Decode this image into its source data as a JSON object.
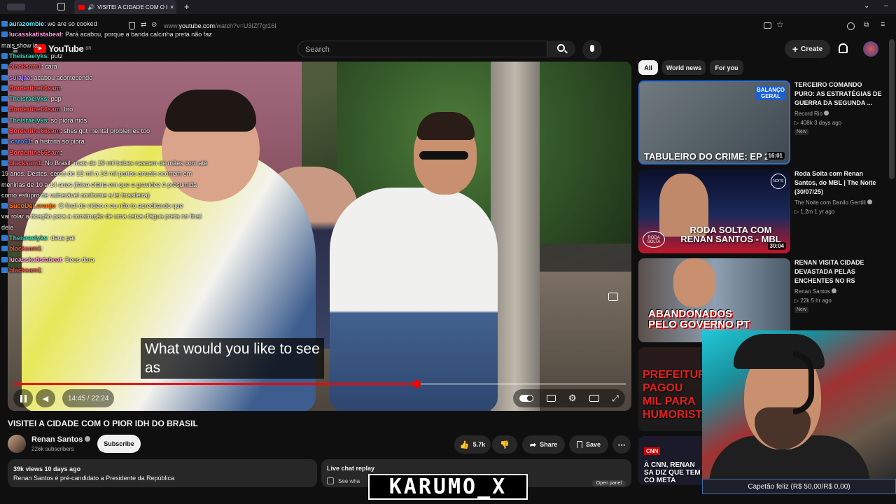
{
  "browser": {
    "tab_title": "VISITEI A CIDADE COM O PI",
    "url_prefix": "www.",
    "url_domain": "youtube.com",
    "url_path": "/watch?v=U3IZf7gt16I"
  },
  "header": {
    "logo": "YouTube",
    "region": "BR",
    "search_placeholder": "Search",
    "create_label": "Create"
  },
  "chat_overlay": [
    {
      "user": "aurazombie",
      "color": "#67e8ff",
      "msg": "we are so cooked"
    },
    {
      "user": "lucasskatistabeat",
      "color": "#ff9bdc",
      "msg": "Pará acabou, porque a banda calcinha preta não faz"
    },
    {
      "user": "",
      "color": "#ffffff",
      "msg": "mais show lá"
    },
    {
      "user": "Theisraelyks",
      "color": "#38d6b6",
      "msg": "putz"
    },
    {
      "user": "blacksam1",
      "color": "#ff4f4f",
      "msg": "cara"
    },
    {
      "user": "sulajaa",
      "color": "#b38cff",
      "msg": "acabou acontecendo"
    },
    {
      "user": "Borderline66sam",
      "color": "#ff4f4f",
      "msg": ""
    },
    {
      "user": "Theisraelyks",
      "color": "#38d6b6",
      "msg": "pqp"
    },
    {
      "user": "Borderline66sam",
      "color": "#ff4f4f",
      "msg": "bro"
    },
    {
      "user": "Theisraelyks",
      "color": "#38d6b6",
      "msg": "só piora mds"
    },
    {
      "user": "Borderline66sam",
      "color": "#ff4f4f",
      "msg": "shes got mental problemes too"
    },
    {
      "user": "icaro91",
      "color": "#4f8fff",
      "msg": "a historia so piora"
    },
    {
      "user": "Borderline66sam",
      "color": "#ff4f4f",
      "msg": ""
    },
    {
      "user": "blacksam1",
      "color": "#ff4f4f",
      "msg": "No Brasil, mais de 19 mil bebes nascem de mães com até"
    },
    {
      "user": "",
      "color": "#ffffff",
      "msg": "19 anos. Destes, cerca de 12 mil a 14 mil partos anuais ocorrem em"
    },
    {
      "user": "",
      "color": "#ffffff",
      "msg": "meninas de 10 a 14 anos (faixa etária em que a gravidez é presumida"
    },
    {
      "user": "",
      "color": "#ffffff",
      "msg": "como estupro de vulnerável conforme a lei brasileira)"
    },
    {
      "user": "SucoDeLaranjo",
      "color": "#ff7a1a",
      "msg": "O final do vídeo e eu não to acreditando que"
    },
    {
      "user": "",
      "color": "#ffffff",
      "msg": "vai rolar a doação para a construção de uma caixa d'água preta no final"
    },
    {
      "user": "",
      "color": "#ffffff",
      "msg": "dele"
    },
    {
      "user": "Theisraelyks",
      "color": "#38d6b6",
      "msg": "deus pai"
    },
    {
      "user": "blacksam1",
      "color": "#ff4f4f",
      "msg": ""
    },
    {
      "user": "lucasskatistabeat",
      "color": "#ff9bdc",
      "msg": "Deus dara"
    },
    {
      "user": "blacksam1",
      "color": "#ff4f4f",
      "msg": ""
    }
  ],
  "video": {
    "caption_line1": "What would you like to see",
    "caption_line2": "as",
    "current_time": "14:45",
    "duration": "22:24",
    "progress": 0.658
  },
  "info": {
    "title": "VISITEI A CIDADE COM O PIOR IDH DO BRASIL",
    "channel": "Renan Santos",
    "subscribers": "226k subscribers",
    "subscribe_label": "Subscribe",
    "likes": "5.7k",
    "share_label": "Share",
    "save_label": "Save",
    "views_date": "39k views  10 days ago",
    "description": "Renan Santos é pré-candidato a Presidente da República",
    "live_chat_label": "Live chat replay",
    "live_chat_sub": "See wha",
    "open_panel": "Open panel"
  },
  "chips": [
    "All",
    "World news",
    "For you"
  ],
  "related": [
    {
      "title": "TERCEIRO COMANDO PURO: AS ESTRATÉGIAS DE GUERRA DA SEGUNDA ...",
      "channel": "Record Rio",
      "meta": "408k  3 days ago",
      "badge": "New",
      "duration": "16:01",
      "thumb_text": "TABULEIRO DO CRIME: EP 2",
      "thumb_tag": "BALANÇO GERAL"
    },
    {
      "title": "Roda Solta com Renan Santos, do MBL | The Noite (30/07/25)",
      "channel": "The Noite com Danilo Gentili",
      "meta": "1.2m  1 yr ago",
      "badge": "",
      "duration": "30:04",
      "thumb_text": "RODA SOLTA COM RENAN SANTOS - MBL",
      "thumb_tag": "RODA SOLTA"
    },
    {
      "title": "RENAN VISITA CIDADE DEVASTADA PELAS ENCHENTES NO RS",
      "channel": "Renan Santos",
      "meta": "22k  5 hr ago",
      "badge": "New",
      "duration": "",
      "thumb_text": "ABANDONADOS PELO GOVERNO PT",
      "thumb_tag": ""
    },
    {
      "title": "",
      "channel": "",
      "meta": "",
      "badge": "",
      "duration": "",
      "thumb_text": "PREFEITURA PAGOU MIL PARA HUMORISTA",
      "thumb_tag": ""
    },
    {
      "title": "",
      "channel": "",
      "meta": "",
      "badge": "",
      "duration": "",
      "thumb_text": "À CNN, RENAN SA DIZ QUE TEM CO META REDUZIR O",
      "thumb_tag": "CNN"
    }
  ],
  "stream": {
    "goal": "Capetão feliz (R$ 50,00/R$ 0,00)",
    "watermark": "KARUMO_X"
  }
}
